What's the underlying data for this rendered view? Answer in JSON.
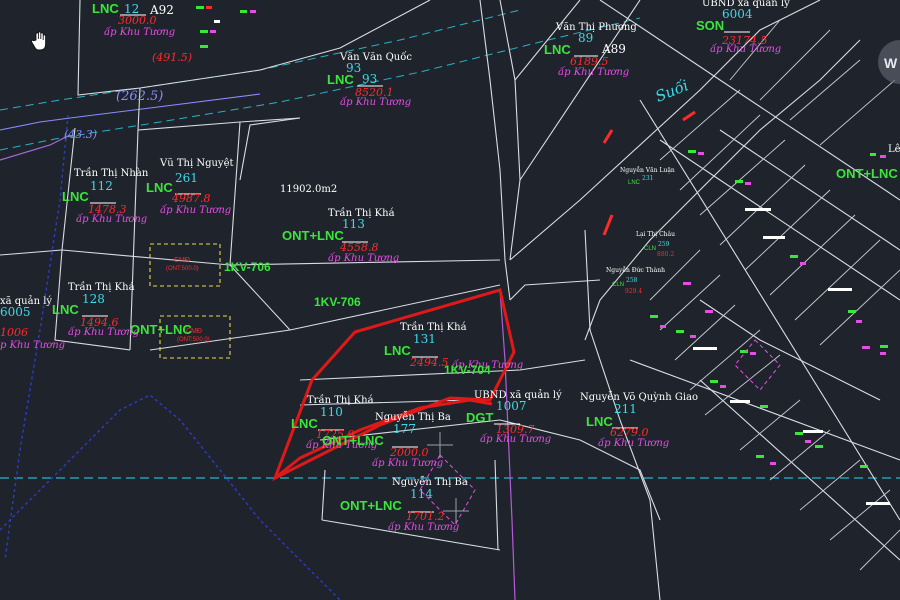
{
  "parcels": [
    {
      "owner": "",
      "use": "LNC",
      "number": "12",
      "area": "3000.0",
      "address": "ấp Khu Tương",
      "sheet": "A92"
    },
    {
      "owner": "Văn Văn Quốc",
      "use": "LNC",
      "number": "93",
      "area": "8520.1",
      "address": "ấp Khu Tương"
    },
    {
      "owner": "Văn Thị Phương",
      "use": "LNC",
      "number": "89",
      "area": "6189.5",
      "address": "ấp Khu Tương",
      "sheet": "A89"
    },
    {
      "owner": "UBND xã quản lý",
      "use": "SON",
      "number": "6004",
      "area": "23174.5",
      "address": "ấp Khu Tương"
    },
    {
      "owner": "Trần Thị Nhàn",
      "use": "LNC",
      "number": "112",
      "area": "1478.3",
      "address": "ấp Khu Tương"
    },
    {
      "owner": "Vũ Thị Nguyệt",
      "use": "LNC",
      "number": "261",
      "area": "4987.8",
      "address": "ấp Khu Tương"
    },
    {
      "owner": "Trần Thị Khá",
      "use": "ONT+LNC",
      "number": "113",
      "area": "4558.8",
      "address": "ấp Khu Tương"
    },
    {
      "owner": "Trần Thị Khá",
      "use": "LNC",
      "number": "128",
      "area": "1494.6",
      "address": "ấp Khu Tương"
    },
    {
      "owner": "Trần Thị Khá",
      "use": "LNC",
      "number": "131",
      "area": "2494.5",
      "address": "ấp Khu Tương"
    },
    {
      "owner": "Trần Thị Khá",
      "use": "LNC",
      "number": "110",
      "area": "1725.9",
      "address": "ấp Khu Tương"
    },
    {
      "owner": "Nguyễn Thị Ba",
      "use": "ONT+LNC",
      "number": "177",
      "area": "2000.0",
      "address": "ấp Khu Tương"
    },
    {
      "owner": "UBND xã quản lý",
      "use": "DGT",
      "number": "1007",
      "area": "1309.7",
      "address": "ấp Khu Tương"
    },
    {
      "owner": "Nguyễn Võ Quỳnh Giao",
      "use": "LNC",
      "number": "211",
      "area": "6279.0",
      "address": "ấp Khu Tương"
    },
    {
      "owner": "Nguyễn Thị Ba",
      "use": "ONT+LNC",
      "number": "114",
      "area": "1701.2",
      "address": "ấp Khu Tương"
    }
  ],
  "left_edge": {
    "owner": "xã quản lý",
    "number": "6005",
    "area": "1006",
    "address": "p Khu Tương"
  },
  "right_edge": {
    "use": "ONT+LNC",
    "owner": "Lê"
  },
  "misc": {
    "area_label": "11902.0m2",
    "power_line_1": "1KV-706",
    "power_line_2": "1KV-706",
    "power_line_3": "1KV-704",
    "stream": "Suối",
    "corridor_1": "(262.5)",
    "corridor_2": "(491.5)",
    "corridor_3": "(43.3)",
    "cmd_1_title": "CMĐ",
    "cmd_1_sub": "(ONT:500.0)",
    "cmd_2_title": "CMĐ",
    "cmd_2_sub": "(ONT:500.0)",
    "stray_use": "ONT+LNC",
    "watermark": "W"
  },
  "small_parcels": [
    {
      "owner": "Nguyễn Văn Luận",
      "use": "LNC",
      "number": "231"
    },
    {
      "owner": "Lại Thị Châu",
      "use": "CLN",
      "number": "259",
      "area": "880.2"
    },
    {
      "owner": "Nguyễn Đức Thành",
      "use": "CLN",
      "number": "258",
      "area": "929.4"
    }
  ],
  "colors": {
    "background": "#1f242c",
    "boundary": "#d8dde4",
    "highlight": "#e01818",
    "land_use": "#39e639",
    "number": "#3fd9e8",
    "area": "#ff2a2a",
    "address": "#e64de6",
    "owner": "#ffffff",
    "power": "#39e639",
    "cmd_box": "#e6d84d",
    "corridor": "#8a8cff",
    "road_blue": "#2a3cc8"
  },
  "icons": [
    "hand-cursor-icon"
  ]
}
